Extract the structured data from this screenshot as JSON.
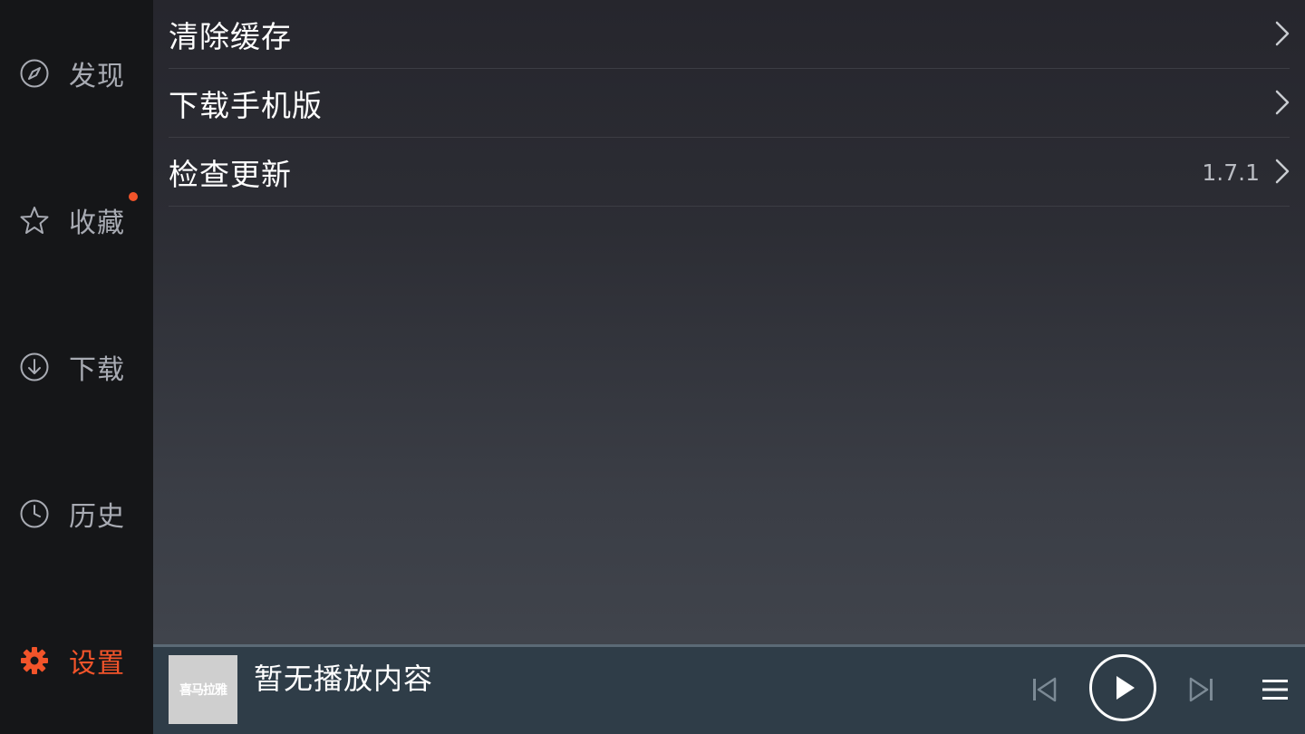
{
  "sidebar": {
    "items": [
      {
        "label": "发现",
        "icon": "compass-icon"
      },
      {
        "label": "收藏",
        "icon": "star-icon",
        "badge": true
      },
      {
        "label": "下载",
        "icon": "download-icon"
      },
      {
        "label": "历史",
        "icon": "clock-icon"
      },
      {
        "label": "设置",
        "icon": "gear-icon",
        "active": true
      }
    ]
  },
  "settings": {
    "rows": [
      {
        "label": "清除缓存",
        "value": ""
      },
      {
        "label": "下载手机版",
        "value": ""
      },
      {
        "label": "检查更新",
        "value": "1.7.1"
      }
    ]
  },
  "player": {
    "title": "暂无播放内容",
    "cover_text": "喜马拉雅"
  },
  "colors": {
    "accent": "#f2542a",
    "sidebar_bg": "#151618",
    "player_bg": "#2f3d48"
  }
}
